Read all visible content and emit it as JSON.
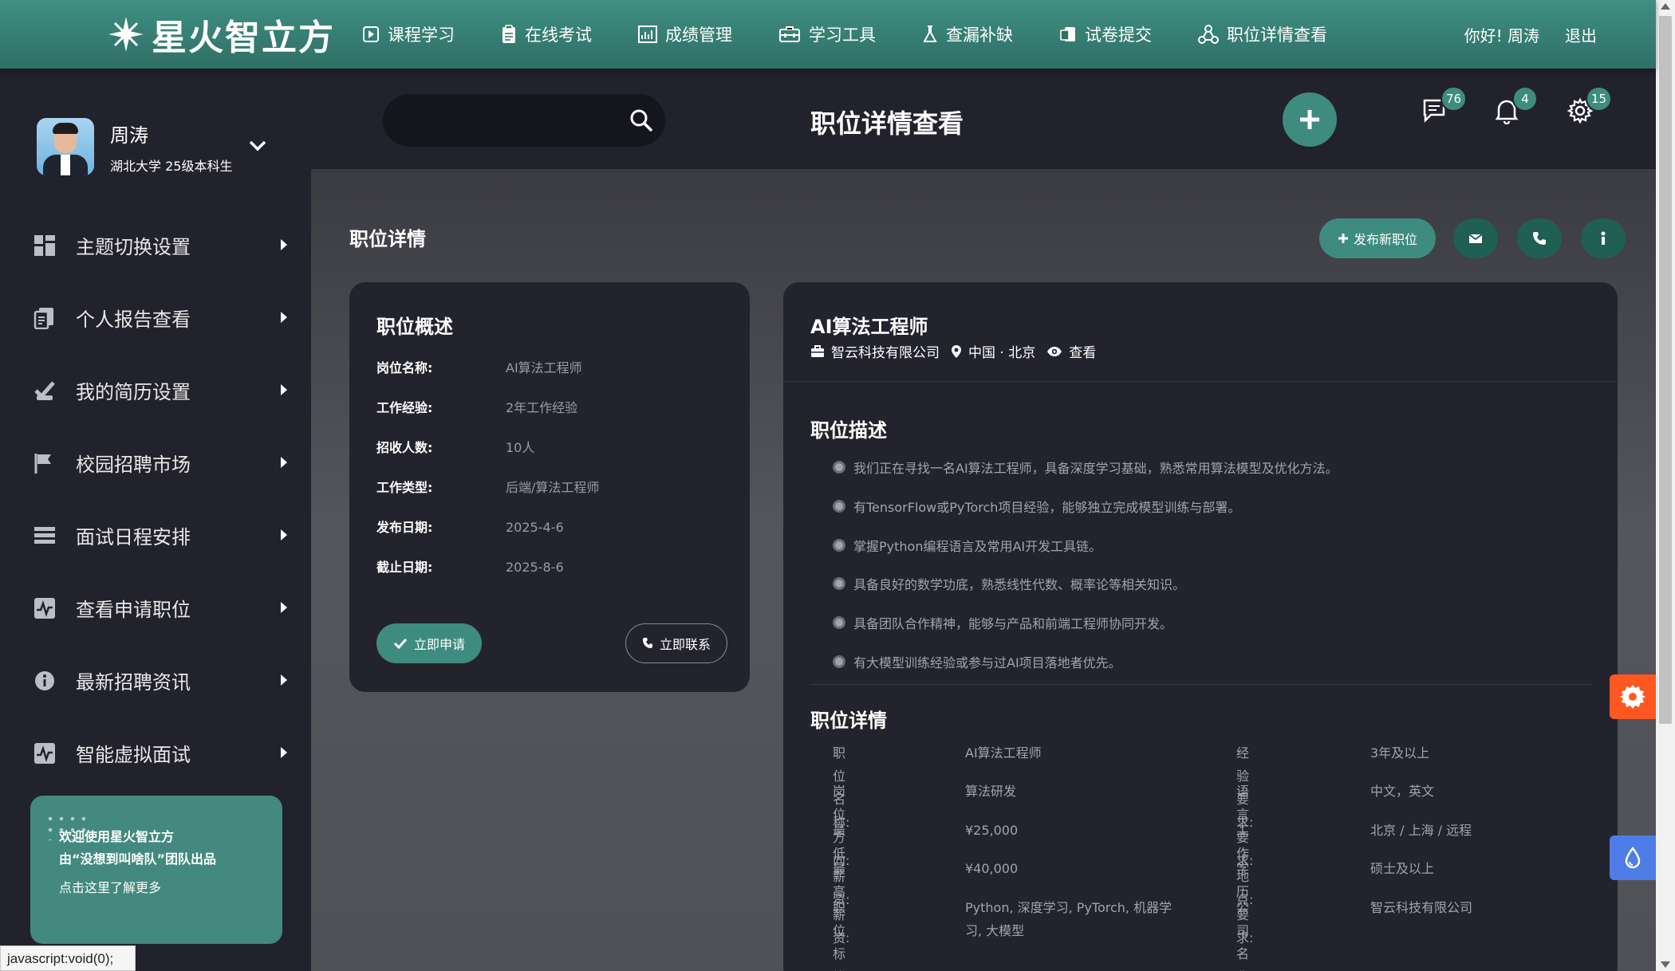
{
  "brand": {
    "name": "星火智立方",
    "logo_icon": "star-logo-icon"
  },
  "nav": [
    {
      "label": "课程学习",
      "icon": "play-square-icon"
    },
    {
      "label": "在线考试",
      "icon": "clipboard-icon"
    },
    {
      "label": "成绩管理",
      "icon": "chart-icon"
    },
    {
      "label": "学习工具",
      "icon": "toolbox-icon"
    },
    {
      "label": "查漏补缺",
      "icon": "flask-icon"
    },
    {
      "label": "试卷提交",
      "icon": "upload-doc-icon"
    },
    {
      "label": "职位详情查看",
      "icon": "network-icon"
    }
  ],
  "user": {
    "greeting": "你好! 周涛",
    "logout": "退出"
  },
  "profile": {
    "name": "周涛",
    "subtitle": "湖北大学 25级本科生"
  },
  "sidebar": {
    "items": [
      {
        "label": "主题切换设置",
        "icon": "dashboard-icon"
      },
      {
        "label": "个人报告查看",
        "icon": "documents-icon"
      },
      {
        "label": "我的简历设置",
        "icon": "resume-check-icon"
      },
      {
        "label": "校园招聘市场",
        "icon": "flag-icon"
      },
      {
        "label": "面试日程安排",
        "icon": "list-icon"
      },
      {
        "label": "查看申请职位",
        "icon": "activity-icon"
      },
      {
        "label": "最新招聘资讯",
        "icon": "info-circle-icon"
      },
      {
        "label": "智能虚拟面试",
        "icon": "pulse-icon"
      }
    ]
  },
  "promo": {
    "line1": "欢迎使用星火智立方",
    "line2": "由“没想到叫啥队”团队出品",
    "link": "点击这里了解更多"
  },
  "statusbar": "javascript:void(0);",
  "header": {
    "title": "职位详情查看",
    "search_placeholder": "",
    "messages_count": "76",
    "notifications_count": "4",
    "settings_count": "15"
  },
  "section": {
    "title": "职位详情",
    "publish_label": "发布新职位"
  },
  "overview": {
    "title": "职位概述",
    "rows": [
      {
        "k": "岗位名称:",
        "v": "AI算法工程师"
      },
      {
        "k": "工作经验:",
        "v": "2年工作经验"
      },
      {
        "k": "招收人数:",
        "v": "10人"
      },
      {
        "k": "工作类型:",
        "v": "后端/算法工程师"
      },
      {
        "k": "发布日期:",
        "v": "2025-4-6"
      },
      {
        "k": "截止日期:",
        "v": "2025-8-6"
      }
    ],
    "apply_label": "立即申请",
    "contact_label": "立即联系"
  },
  "job": {
    "title": "AI算法工程师",
    "company": "智云科技有限公司",
    "location": "中国 · 北京",
    "view_label": "查看",
    "desc_title": "职位描述",
    "desc": [
      "我们正在寻找一名AI算法工程师，具备深度学习基础，熟悉常用算法模型及优化方法。",
      "有TensorFlow或PyTorch项目经验，能够独立完成模型训练与部署。",
      "掌握Python编程语言及常用AI开发工具链。",
      "具备良好的数学功底，熟悉线性代数、概率论等相关知识。",
      "具备团队合作精神，能够与产品和前端工程师协同开发。",
      "有大模型训练经验或参与过AI项目落地者优先。"
    ],
    "info_title": "职位详情",
    "info": [
      {
        "k": "职位名称:",
        "v": "AI算法工程师",
        "k2": "经验要求:",
        "v2": "3年及以上"
      },
      {
        "k": "岗位方向:",
        "v": "算法研发",
        "k2": "语言要求:",
        "v2": "中文，英文"
      },
      {
        "k": "最低薪资:",
        "v": "¥25,000",
        "k2": "工作地点:",
        "v2": "北京 / 上海 / 远程"
      },
      {
        "k": "最高薪资:",
        "v": "¥40,000",
        "k2": "学历要求:",
        "v2": "硕士及以上"
      },
      {
        "k": "职位标签:",
        "v": "Python, 深度学习, PyTorch, 机器学习, 大模型",
        "k2": "公司名称:",
        "v2": "智云科技有限公司"
      }
    ]
  },
  "colors": {
    "accent": "#3e8c80",
    "topbar": "#3f8f83",
    "panel": "#23232e",
    "settings_float": "#ff5722",
    "theme_float": "#4f7de8"
  }
}
